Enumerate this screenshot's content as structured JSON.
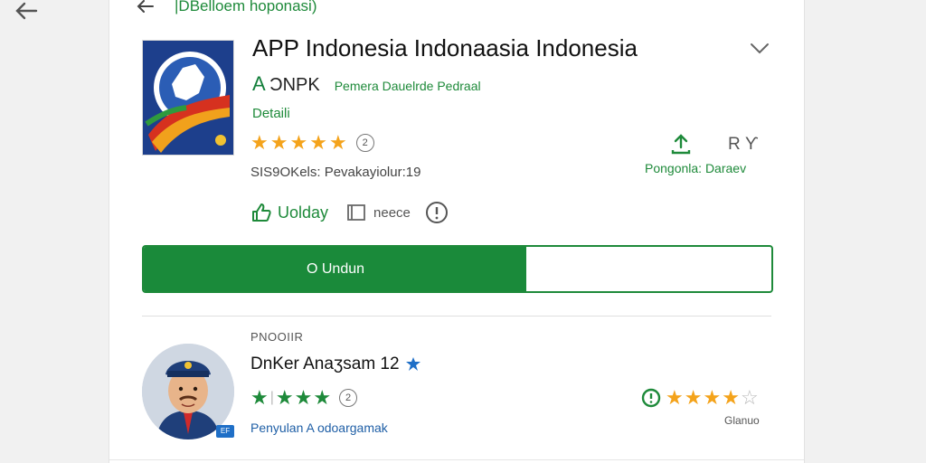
{
  "header": {
    "title": "|DBelloem hoponasi)"
  },
  "app": {
    "title": "APP Indonesia Indonaasia  Indonesia",
    "developer_prefix": "A",
    "developer_name": "ƆNPK",
    "category": "Pemera Dauelrde Pedraal",
    "details_link": "Detaili",
    "rating_badge": "2",
    "size_text": "R Ƴ",
    "status_text": "Pongonla: Daraev",
    "meta_text": "SIS9OKels: Pevakayiolur:19",
    "actions": {
      "like_label": "Uolday",
      "note_label": "neece"
    },
    "download": {
      "label": "O Undun",
      "progress": 0.61,
      "color": "#1a8a3a"
    }
  },
  "review": {
    "section_label": "PNOOIIR",
    "name": "DnKer Anaʒsam 12",
    "badge": "2",
    "subtext": "Penyulan A odoargamak",
    "avatar_badge": "EF",
    "right_caption": "Glanuo",
    "left_stars": 4,
    "right_stars": 4
  },
  "colors": {
    "accent_green": "#1e8a3a",
    "star_orange": "#f4a31b",
    "link_blue": "#1f5fa6"
  },
  "icons": {
    "back": "arrow-left-icon",
    "collapse": "chevron-down-icon",
    "share": "share-icon",
    "like": "thumbs-up-icon",
    "note": "note-icon",
    "info": "info-icon",
    "verified": "verified-icon",
    "clock": "clock-icon"
  }
}
